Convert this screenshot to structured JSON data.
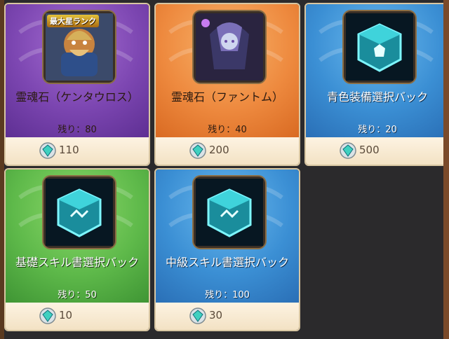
{
  "shop": {
    "items": [
      {
        "name": "霊魂石（ケンタウロス）",
        "remaining": "残り：80",
        "price": "110",
        "badge": "最大星ランク",
        "icon": "centaur-hero-icon",
        "color": "#7c46b1"
      },
      {
        "name": "霊魂石（ファントム）",
        "remaining": "残り：40",
        "price": "200",
        "icon": "phantom-hero-icon",
        "color": "#ee8a3f"
      },
      {
        "name": "青色装備選択バック",
        "remaining": "残り：20",
        "price": "500",
        "icon": "equipment-cube-icon",
        "color": "#3b8fd4"
      },
      {
        "name": "基礎スキル書選択バック",
        "remaining": "残り：50",
        "price": "10",
        "icon": "skill-book-cube-icon",
        "color": "#5eb94a"
      },
      {
        "name": "中級スキル書選択バック",
        "remaining": "残り：100",
        "price": "30",
        "icon": "skill-book-cube-icon",
        "color": "#3b8fd4"
      }
    ],
    "currency_icon": "gem-icon"
  }
}
